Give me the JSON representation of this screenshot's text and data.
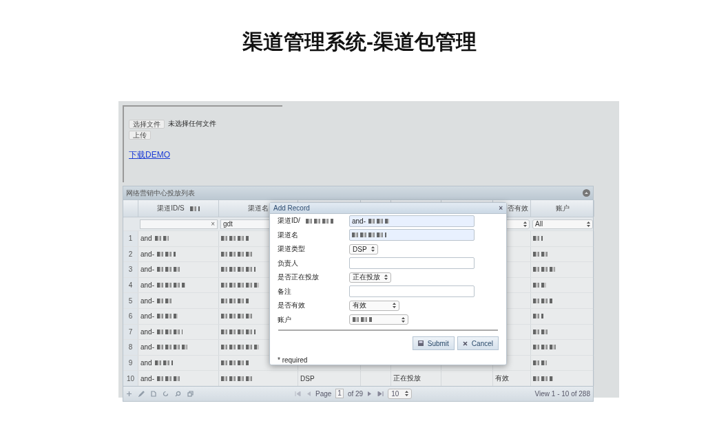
{
  "slide_title": "渠道管理系统-渠道包管理",
  "upload": {
    "choose_button": "选择文件",
    "file_status": "未选择任何文件",
    "upload_button": "上传",
    "download_link": "下载DEMO"
  },
  "grid": {
    "caption": "网络营销中心投放列表",
    "columns": [
      {
        "label": "渠道ID/S",
        "redacted": true,
        "filter": {
          "kind": "text",
          "clear": "×"
        }
      },
      {
        "label": "渠道名",
        "redacted": false,
        "filter": {
          "kind": "text",
          "value": "gdt"
        }
      },
      {
        "label": "否有效",
        "redacted": false,
        "filter": {
          "kind": "select"
        }
      },
      {
        "label": "账户",
        "redacted": false,
        "filter": {
          "kind": "select",
          "value": "All"
        }
      }
    ],
    "rows": [
      {
        "num": "1",
        "id": "and"
      },
      {
        "num": "2",
        "id": "and-"
      },
      {
        "num": "3",
        "id": "and-"
      },
      {
        "num": "4",
        "id": "and-"
      },
      {
        "num": "5",
        "id": "and-"
      },
      {
        "num": "6",
        "id": "and-"
      },
      {
        "num": "7",
        "id": "and-"
      },
      {
        "num": "8",
        "id": "and-"
      },
      {
        "num": "9",
        "id": "and"
      },
      {
        "num": "10",
        "id": "and-",
        "type": "DSP",
        "status": "正在投放",
        "valid": "有效"
      }
    ],
    "pager": {
      "page_label": "Page",
      "page": "1",
      "of": "of 29",
      "page_size": "10",
      "view": "View 1 - 10 of 288"
    }
  },
  "dialog": {
    "title": "Add Record",
    "close": "×",
    "fields": [
      {
        "label": "渠道ID/",
        "label_redacted": true,
        "kind": "text",
        "value": "and-",
        "redacted": true,
        "autofilled": true
      },
      {
        "label": "渠道名",
        "label_redacted": false,
        "kind": "text",
        "redacted": true,
        "autofilled": true
      },
      {
        "label": "渠道类型",
        "label_redacted": false,
        "kind": "select",
        "value": "DSP",
        "redacted": false
      },
      {
        "label": "负责人",
        "label_redacted": false,
        "kind": "text",
        "redacted": false,
        "autofilled": false
      },
      {
        "label": "是否正在投放",
        "label_redacted": false,
        "kind": "select",
        "value": "正在投放",
        "redacted": false
      },
      {
        "label": "备注",
        "label_redacted": false,
        "kind": "text",
        "redacted": false,
        "autofilled": false
      },
      {
        "label": "是否有效",
        "label_redacted": false,
        "kind": "select",
        "value": "有效",
        "redacted": false
      },
      {
        "label": "账户",
        "label_redacted": false,
        "kind": "select",
        "redacted": true
      }
    ],
    "buttons": [
      {
        "kind": "submit",
        "label": "Submit"
      },
      {
        "kind": "cancel",
        "label": "Cancel"
      }
    ],
    "note": "* required"
  }
}
